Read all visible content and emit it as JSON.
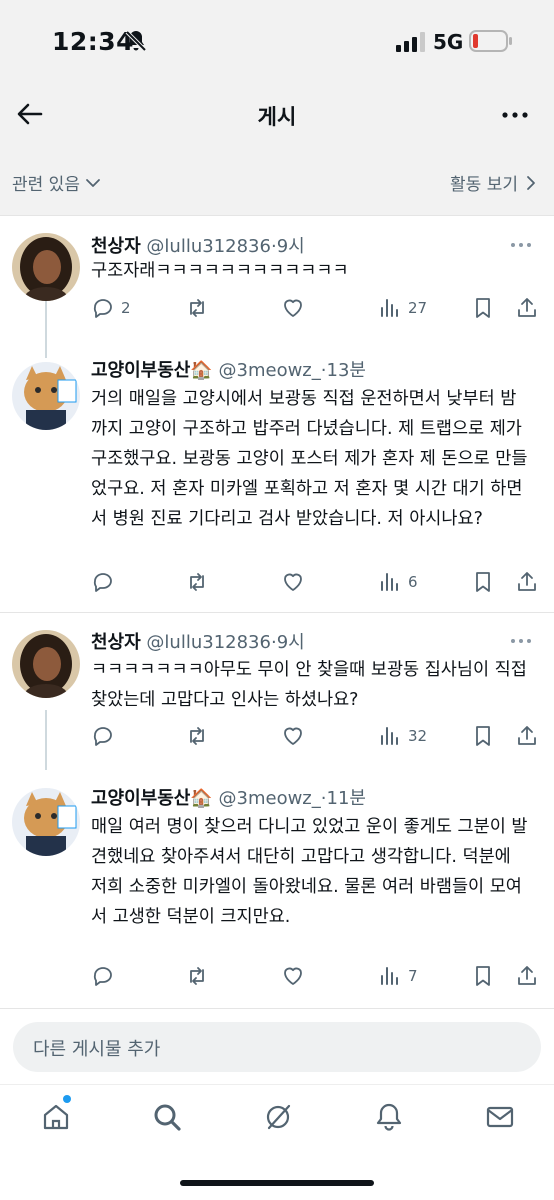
{
  "status_bar": {
    "time": "12:34",
    "network": "5G",
    "icons": [
      "bell-off-icon",
      "signal-icon",
      "battery-icon"
    ],
    "battery_color": "#e0392e"
  },
  "header": {
    "title": "게시",
    "back_icon": "arrow-left-icon",
    "more_icon": "more-horizontal-icon"
  },
  "filter_bar": {
    "sort_label": "관련 있음",
    "activity_label": "활동 보기"
  },
  "tweets": [
    {
      "name": "천상자",
      "handle": "@lullu312836",
      "time": "9시",
      "text": "구조자래ㅋㅋㅋㅋㅋㅋㅋㅋㅋㅋㅋㅋ",
      "replies": "2",
      "retweets": "",
      "likes": "",
      "views": "27"
    },
    {
      "name": "고양이부동산🏠",
      "handle": "@3meowz_",
      "time": "13분",
      "text": "거의 매일을 고양시에서 보광동 직접 운전하면서 낮부터 밤까지 고양이 구조하고 밥주러 다녔습니다. 제 트랩으로 제가 구조했구요. 보광동 고양이 포스터 제가 혼자 제 돈으로 만들었구요. 저 혼자 미카엘 포획하고 저 혼자 몇 시간 대기 하면서 병원 진료 기다리고 검사 받았습니다. 저 아시나요?",
      "replies": "",
      "retweets": "",
      "likes": "",
      "views": "6"
    },
    {
      "name": "천상자",
      "handle": "@lullu312836",
      "time": "9시",
      "text": "ㅋㅋㅋㅋㅋㅋㅋ아무도 무이 안 찾을때 보광동 집사님이 직접 찾았는데 고맙다고 인사는 하셨나요?",
      "replies": "",
      "retweets": "",
      "likes": "",
      "views": "32"
    },
    {
      "name": "고양이부동산🏠",
      "handle": "@3meowz_",
      "time": "11분",
      "text": "매일 여러 명이 찾으러 다니고 있었고 운이 좋게도 그분이 발견했네요 찾아주셔서 대단히 고맙다고 생각합니다. 덕분에 저희 소중한 미카엘이 돌아왔네요. 물론 여러 바램들이 모여서 고생한 덕분이 크지만요.",
      "replies": "",
      "retweets": "",
      "likes": "",
      "views": "7"
    }
  ],
  "reply_box": {
    "placeholder": "다른 게시물 추가"
  },
  "bottom_nav": {
    "items": [
      "home-icon",
      "search-icon",
      "grok-icon",
      "notifications-icon",
      "messages-icon"
    ],
    "accent": "#1d9bf0"
  }
}
